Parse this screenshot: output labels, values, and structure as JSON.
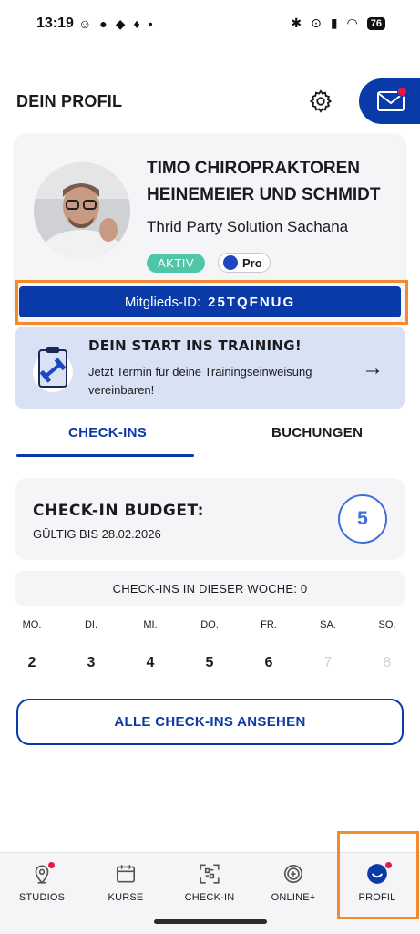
{
  "status_bar": {
    "time": "13:19",
    "battery": "76"
  },
  "header": {
    "title": "DEIN PROFIL",
    "settings_icon": "gear-icon",
    "mail_icon": "mail-icon"
  },
  "profile": {
    "name": "TIMO CHIROPRAKTOREN HEINEMEIER UND SCHMIDT",
    "company": "Thrid Party Solution Sachana",
    "status_badge": "AKTIV",
    "tier_badge": "Pro",
    "member_id_label": "Mitglieds-ID:",
    "member_id": "25TQFNUG"
  },
  "training_banner": {
    "title": "DEIN START INS TRAINING!",
    "text": "Jetzt Termin für deine Trainingseinweisung vereinbaren!",
    "icon": "clipboard-dumbbell-icon"
  },
  "tabs": [
    {
      "label": "CHECK-INS",
      "active": true
    },
    {
      "label": "BUCHUNGEN",
      "active": false
    }
  ],
  "budget": {
    "title": "CHECK-IN BUDGET:",
    "valid_until": "GÜLTIG BIS 28.02.2026",
    "count": "5"
  },
  "week": {
    "summary": "CHECK-INS IN DIESER WOCHE: 0",
    "days": [
      {
        "label": "MO.",
        "date": "2",
        "enabled": true
      },
      {
        "label": "DI.",
        "date": "3",
        "enabled": true
      },
      {
        "label": "MI.",
        "date": "4",
        "enabled": true
      },
      {
        "label": "DO.",
        "date": "5",
        "enabled": true
      },
      {
        "label": "FR.",
        "date": "6",
        "enabled": true
      },
      {
        "label": "SA.",
        "date": "7",
        "enabled": false
      },
      {
        "label": "SO.",
        "date": "8",
        "enabled": false
      }
    ]
  },
  "all_checkins_button": "ALLE CHECK-INS ANSEHEN",
  "bottom_nav": [
    {
      "label": "STUDIOS",
      "icon": "location-pin-icon",
      "dot": true
    },
    {
      "label": "KURSE",
      "icon": "calendar-icon",
      "dot": false
    },
    {
      "label": "CHECK-IN",
      "icon": "qr-scan-icon",
      "dot": false
    },
    {
      "label": "ONLINE+",
      "icon": "online-plus-icon",
      "dot": false
    },
    {
      "label": "PROFIL",
      "icon": "profile-icon",
      "dot": true,
      "active": true
    }
  ],
  "colors": {
    "brand_blue": "#0a3aa8",
    "accent_red": "#e8174a",
    "active_green": "#4dc7a8",
    "highlight_orange": "#f38a2d",
    "banner_bg": "#d9e2f5"
  }
}
